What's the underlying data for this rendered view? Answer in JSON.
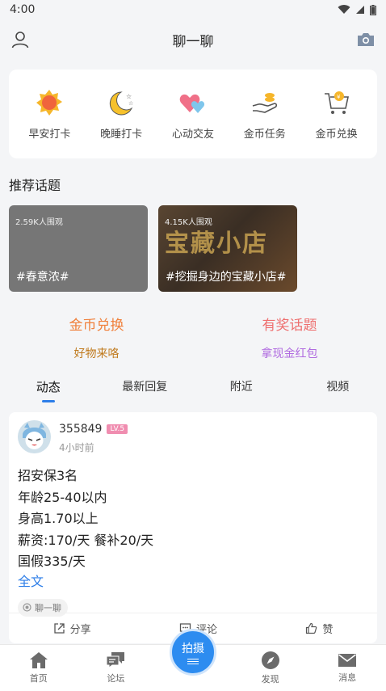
{
  "status": {
    "time": "4:00"
  },
  "header": {
    "title": "聊一聊"
  },
  "quick_actions": [
    {
      "label": "早安打卡",
      "icon": "sun-icon"
    },
    {
      "label": "晚睡打卡",
      "icon": "moon-stars-icon"
    },
    {
      "label": "心动交友",
      "icon": "hearts-icon"
    },
    {
      "label": "金币任务",
      "icon": "coin-hand-icon"
    },
    {
      "label": "金币兑换",
      "icon": "coin-cart-icon"
    }
  ],
  "recommended": {
    "title": "推荐话题",
    "topics": [
      {
        "count": "2.59K人围观",
        "name": "#春意浓#"
      },
      {
        "count": "4.15K人围观",
        "name": "#挖掘身边的宝藏小店#",
        "overlay": "宝藏小店"
      }
    ]
  },
  "promos": [
    {
      "main": "金币兑换",
      "sub": "好物来咯",
      "main_color": "#f0803c",
      "sub_color": "#c07a1e"
    },
    {
      "main": "有奖话题",
      "sub": "拿现金红包",
      "main_color": "#ee6f6f",
      "sub_color": "#b06be0"
    }
  ],
  "tabs": [
    "动态",
    "最新回复",
    "附近",
    "视频"
  ],
  "post": {
    "username": "355849",
    "level": "LV.5",
    "time": "4小时前",
    "lines": [
      "招安保3名",
      "年龄25-40以内",
      "身高1.70以上",
      "薪资:170/天 餐补20/天",
      "国假335/天"
    ],
    "read_more": "全文",
    "tag": "聊一聊",
    "actions": {
      "share": "分享",
      "comment": "评论",
      "like": "赞"
    }
  },
  "bottom_nav": {
    "home": "首页",
    "forum": "论坛",
    "shoot": "拍摄",
    "discover": "发现",
    "messages": "消息"
  },
  "colors": {
    "accent": "#2d7ee8",
    "shoot_button": "#2d8cf0"
  }
}
